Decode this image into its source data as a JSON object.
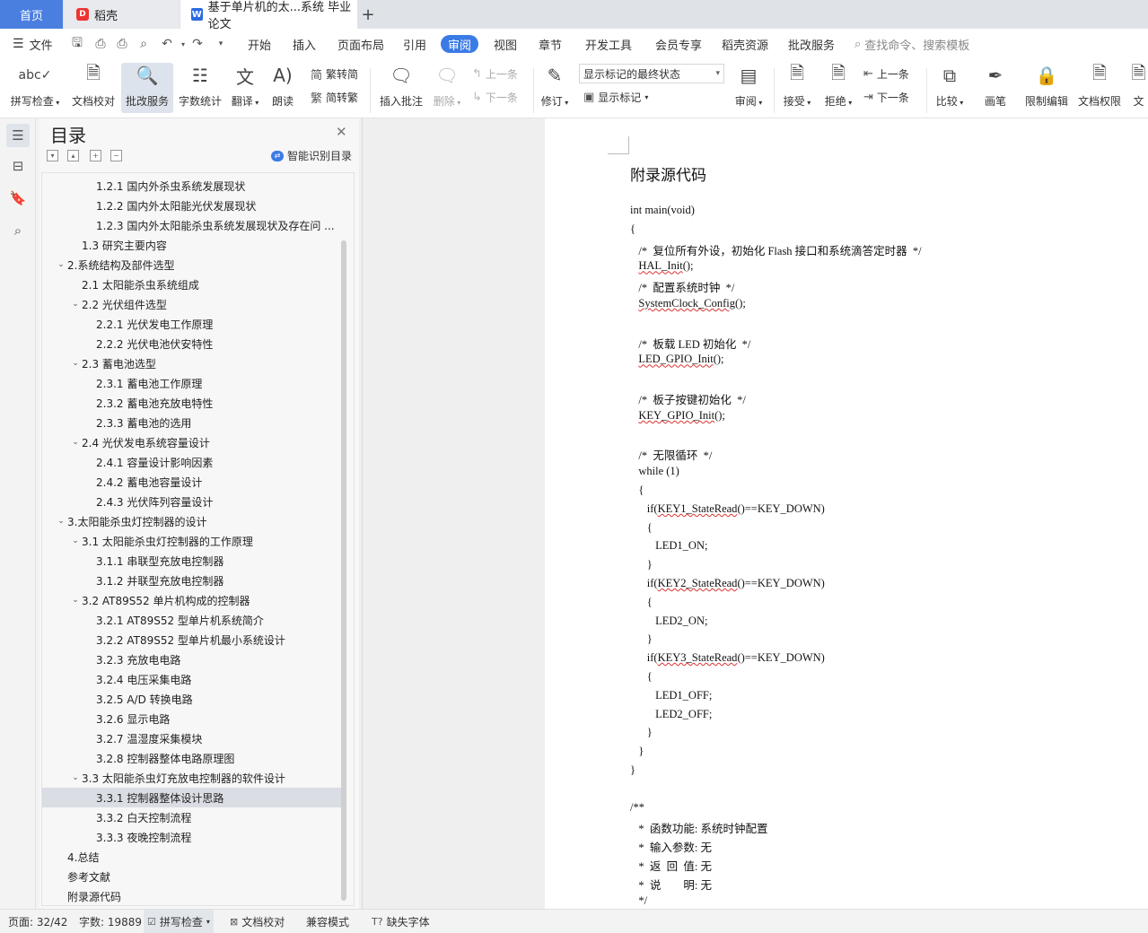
{
  "tabs": {
    "home": "首页",
    "daoke": "稻壳",
    "document": "基于单片机的太...系统 毕业论文"
  },
  "menu": {
    "file": "文件",
    "items": [
      "开始",
      "插入",
      "页面布局",
      "引用",
      "审阅",
      "视图",
      "章节",
      "开发工具",
      "会员专享",
      "稻壳资源",
      "批改服务"
    ],
    "active": "审阅",
    "search_placeholder": "查找命令、搜索模板"
  },
  "ribbon": {
    "spell_check": "拼写检查",
    "doc_proof": "文档校对",
    "review_service": "批改服务",
    "word_count": "字数统计",
    "translate": "翻译",
    "read_aloud": "朗读",
    "trad_to_simp": "繁转简",
    "simp_to_trad": "简转繁",
    "insert_comment": "插入批注",
    "delete": "删除",
    "prev": "上一条",
    "next": "下一条",
    "track_changes": "修订",
    "markup_state": "显示标记的最终状态",
    "show_markup": "显示标记",
    "review": "审阅",
    "accept": "接受",
    "reject": "拒绝",
    "prev2": "上一条",
    "next2": "下一条",
    "compare": "比较",
    "pen": "画笔",
    "restrict_edit": "限制编辑",
    "doc_permission": "文档权限",
    "doc_cut": "文"
  },
  "toc": {
    "title": "目录",
    "smart_toc": "智能识别目录",
    "items": [
      {
        "label": "1.2.1 国内外杀虫系统发展现状",
        "level": 3,
        "chev": ""
      },
      {
        "label": "1.2.2 国内外太阳能光伏发展现状",
        "level": 3,
        "chev": ""
      },
      {
        "label": "1.2.3 国内外太阳能杀虫系统发展现状及存在问 ...",
        "level": 3,
        "chev": ""
      },
      {
        "label": "1.3  研究主要内容",
        "level": 2,
        "chev": ""
      },
      {
        "label": "2.系统结构及部件选型",
        "level": 1,
        "chev": "v"
      },
      {
        "label": "2.1 太阳能杀虫系统组成",
        "level": 2,
        "chev": ""
      },
      {
        "label": "2.2 光伏组件选型",
        "level": 2,
        "chev": "v"
      },
      {
        "label": "2.2.1 光伏发电工作原理",
        "level": 3,
        "chev": ""
      },
      {
        "label": "2.2.2 光伏电池伏安特性",
        "level": 3,
        "chev": ""
      },
      {
        "label": "2.3 蓄电池选型",
        "level": 2,
        "chev": "v"
      },
      {
        "label": "2.3.1 蓄电池工作原理",
        "level": 3,
        "chev": ""
      },
      {
        "label": "2.3.2 蓄电池充放电特性",
        "level": 3,
        "chev": ""
      },
      {
        "label": "2.3.3 蓄电池的选用",
        "level": 3,
        "chev": ""
      },
      {
        "label": "2.4 光伏发电系统容量设计",
        "level": 2,
        "chev": "v"
      },
      {
        "label": "2.4.1 容量设计影响因素",
        "level": 3,
        "chev": ""
      },
      {
        "label": "2.4.2 蓄电池容量设计",
        "level": 3,
        "chev": ""
      },
      {
        "label": "2.4.3 光伏阵列容量设计",
        "level": 3,
        "chev": ""
      },
      {
        "label": "3.太阳能杀虫灯控制器的设计",
        "level": 1,
        "chev": "v"
      },
      {
        "label": "3.1 太阳能杀虫灯控制器的工作原理",
        "level": 2,
        "chev": "v"
      },
      {
        "label": "3.1.1 串联型充放电控制器",
        "level": 3,
        "chev": ""
      },
      {
        "label": "3.1.2 并联型充放电控制器",
        "level": 3,
        "chev": ""
      },
      {
        "label": "3.2 AT89S52  单片机构成的控制器",
        "level": 2,
        "chev": "v"
      },
      {
        "label": "3.2.1 AT89S52  型单片机系统简介",
        "level": 3,
        "chev": ""
      },
      {
        "label": "3.2.2 AT89S52  型单片机最小系统设计",
        "level": 3,
        "chev": ""
      },
      {
        "label": "3.2.3  充放电电路",
        "level": 3,
        "chev": ""
      },
      {
        "label": "3.2.4  电压采集电路",
        "level": 3,
        "chev": ""
      },
      {
        "label": "3.2.5 A/D  转换电路",
        "level": 3,
        "chev": ""
      },
      {
        "label": "3.2.6  显示电路",
        "level": 3,
        "chev": ""
      },
      {
        "label": "3.2.7  温湿度采集模块",
        "level": 3,
        "chev": ""
      },
      {
        "label": "3.2.8 控制器整体电路原理图",
        "level": 3,
        "chev": ""
      },
      {
        "label": "3.3 太阳能杀虫灯充放电控制器的软件设计",
        "level": 2,
        "chev": "v"
      },
      {
        "label": "3.3.1 控制器整体设计思路",
        "level": 3,
        "chev": "",
        "selected": true
      },
      {
        "label": "3.3.2 白天控制流程",
        "level": 3,
        "chev": ""
      },
      {
        "label": "3.3.3 夜晚控制流程",
        "level": 3,
        "chev": ""
      },
      {
        "label": "4.总结",
        "level": 1,
        "chev": ""
      },
      {
        "label": "参考文献",
        "level": 1,
        "chev": ""
      },
      {
        "label": "附录源代码",
        "level": 1,
        "chev": ""
      }
    ]
  },
  "document": {
    "heading": "附录源代码",
    "lines": [
      "int main(void)",
      "{",
      "   /*  复位所有外设，初始化 Flash 接口和系统滴答定时器  */",
      "   HAL_Init();",
      "   /*  配置系统时钟  */",
      "   SystemClock_Config();",
      "",
      "   /*  板载 LED 初始化  */",
      "   LED_GPIO_Init();",
      "",
      "   /*  板子按键初始化  */",
      "   KEY_GPIO_Init();",
      "",
      "   /*  无限循环  */",
      "   while (1)",
      "   {",
      "      if(KEY1_StateRead()==KEY_DOWN)",
      "      {",
      "         LED1_ON;",
      "      }",
      "      if(KEY2_StateRead()==KEY_DOWN)",
      "      {",
      "         LED2_ON;",
      "      }",
      "      if(KEY3_StateRead()==KEY_DOWN)",
      "      {",
      "         LED1_OFF;",
      "         LED2_OFF;",
      "      }",
      "   }",
      "}",
      "",
      "/**",
      "   *  函数功能: 系统时钟配置",
      "   *  输入参数: 无",
      "   *  返  回  值: 无",
      "   *  说        明: 无",
      "   */"
    ]
  },
  "status": {
    "page": "页面: 32/42",
    "words": "字数: 19889",
    "spell_check": "拼写检查",
    "doc_proof": "文档校对",
    "compat": "兼容模式",
    "missing_font": "缺失字体"
  },
  "colors": {
    "accent": "#3b7be6",
    "home_tab": "#4a7fe0",
    "squiggle": "#dd3333"
  }
}
